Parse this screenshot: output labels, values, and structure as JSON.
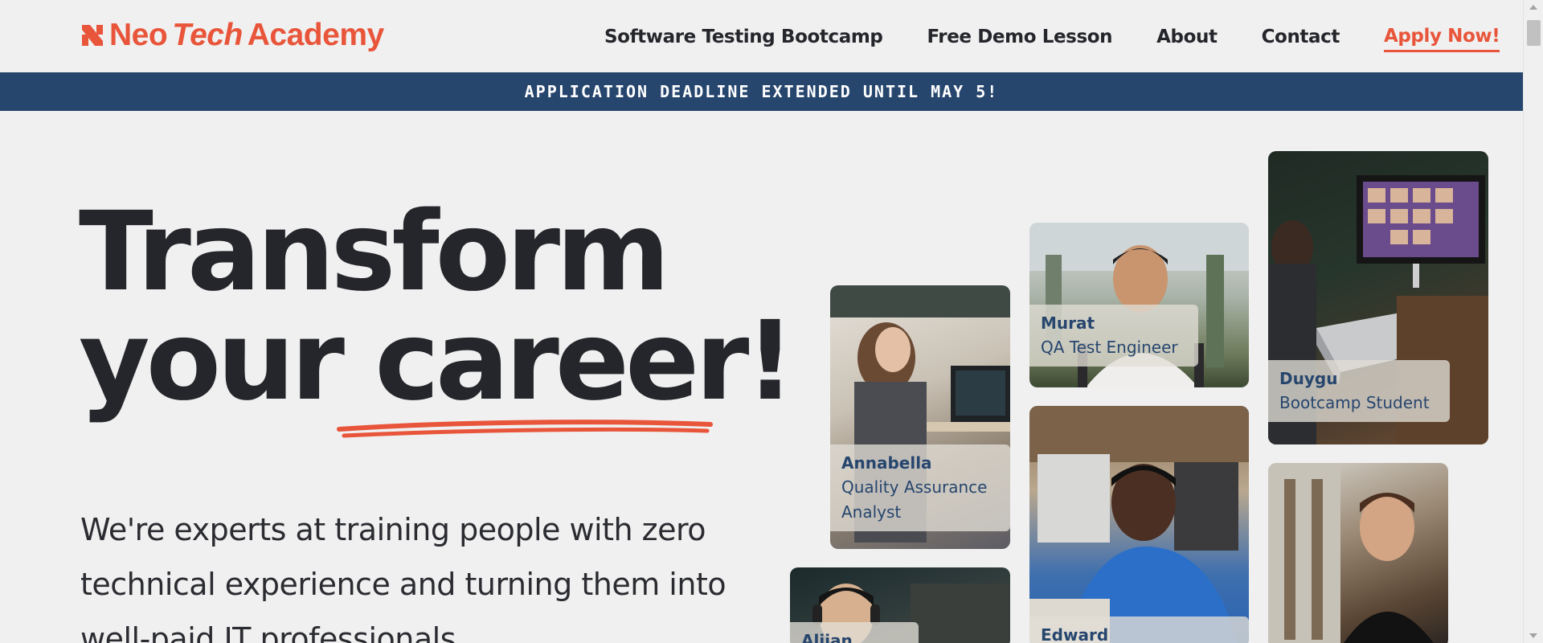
{
  "brand": {
    "name_part1": "Neo",
    "name_part2": "Tech",
    "name_part3": "Academy",
    "color": "#e8553a"
  },
  "nav": {
    "items": [
      {
        "label": "Software Testing Bootcamp"
      },
      {
        "label": "Free Demo Lesson"
      },
      {
        "label": "About"
      },
      {
        "label": "Contact"
      },
      {
        "label": "Apply Now!"
      }
    ]
  },
  "banner": {
    "text": "APPLICATION DEADLINE EXTENDED UNTIL MAY 5!",
    "color": "#27466e"
  },
  "hero": {
    "headline_word1": "Transform",
    "headline_word2": "your",
    "headline_word3": "career!",
    "lead": "We're experts at training people with zero technical experience and turning them into well-paid IT professionals."
  },
  "cards": [
    {
      "name": "Annabella",
      "role": "Quality Assurance Analyst"
    },
    {
      "name": "Murat",
      "role": "QA Test Engineer"
    },
    {
      "name": "Duygu",
      "role": "Bootcamp Student"
    },
    {
      "name": "Edward",
      "role": ""
    },
    {
      "name": "Alijan",
      "role": ""
    }
  ],
  "icons": {
    "logo": "logo-icon",
    "scroll_up": "scroll-up-icon",
    "scroll_down": "scroll-down-icon"
  }
}
